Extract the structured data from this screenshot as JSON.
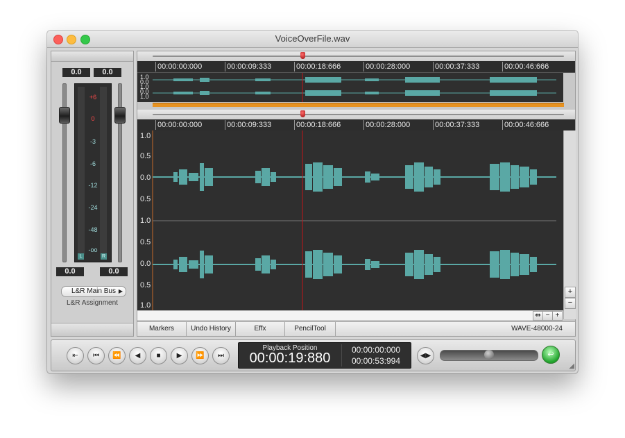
{
  "window": {
    "title": "VoiceOverFile.wav"
  },
  "meter": {
    "top_left_value": "0.0",
    "top_right_value": "0.0",
    "bottom_left_value": "0.0",
    "bottom_right_value": "0.0",
    "scale": [
      "+6",
      "0",
      "-3",
      "-6",
      "-12",
      "-24",
      "-48",
      "-oo"
    ],
    "channel_left": "L",
    "channel_right": "R",
    "bus_button": "L&R Main Bus",
    "bus_label": "L&R Assignment"
  },
  "overview": {
    "ruler_labels": [
      "00:00:00:000",
      "00:00:09:333",
      "00:00:18:666",
      "00:00:28:000",
      "00:00:37:333",
      "00:00:46:666"
    ],
    "amplitude_labels": [
      "1.0",
      "0.0",
      "1.0",
      "0.0",
      "1.0"
    ]
  },
  "main": {
    "ruler_labels": [
      "00:00:00:000",
      "00:00:09:333",
      "00:00:18:666",
      "00:00:28:000",
      "00:00:37:333",
      "00:00:46:666"
    ],
    "ch1_labels": [
      "1.0",
      "0.5",
      "0.0",
      "0.5"
    ],
    "ch2_labels": [
      "1.0",
      "0.5",
      "0.0",
      "0.5",
      "1.0"
    ]
  },
  "scroll": {
    "plus": "+",
    "minus": "−"
  },
  "tabs": [
    "Markers",
    "Undo History",
    "Effx",
    "PencilTool"
  ],
  "format": "WAVE-48000-24",
  "transport": {
    "position_label": "Playback Position",
    "position": "00:00:19:880",
    "start": "00:00:00:000",
    "total": "00:00:53:994"
  },
  "colors": {
    "waveform": "#5aa8a5",
    "playhead": "#c0141a",
    "orange_bar": "#e79220"
  }
}
